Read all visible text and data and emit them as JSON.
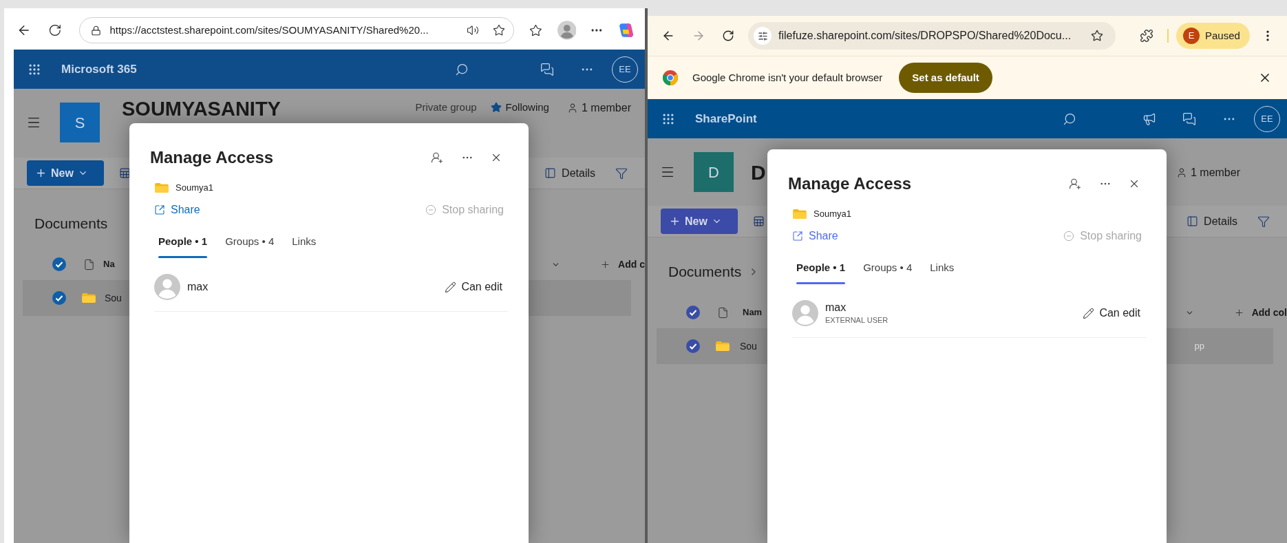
{
  "left_window": {
    "address": "https://acctstest.sharepoint.com/sites/SOUMYASANITY/Shared%20...",
    "suite_bar": {
      "title": "Microsoft 365",
      "avatar": "EE"
    },
    "site": {
      "logo_letter": "S",
      "title": "SOUMYASANITY",
      "privacy": "Private group",
      "follow": "Following",
      "members": "1 member"
    },
    "command_bar": {
      "new": "New",
      "details": "Details"
    },
    "library": {
      "title": "Documents",
      "header_checked": true,
      "columns": [
        "Na",
        "Add c"
      ],
      "rows": [
        {
          "name": "Sou",
          "selected": true
        }
      ]
    },
    "dialog": {
      "title": "Manage Access",
      "item": "Soumya1",
      "share": "Share",
      "stop_sharing": "Stop sharing",
      "tabs": [
        {
          "label": "People • 1",
          "selected": true
        },
        {
          "label": "Groups • 4",
          "selected": false
        },
        {
          "label": "Links",
          "selected": false
        }
      ],
      "people": [
        {
          "name": "max",
          "permission": "Can edit"
        }
      ]
    }
  },
  "right_window": {
    "address": "filefuze.sharepoint.com/sites/DROPSPO/Shared%20Docu...",
    "profile": {
      "initial": "E",
      "label": "Paused"
    },
    "banner": {
      "text": "Google Chrome isn't your default browser",
      "button": "Set as default"
    },
    "suite_bar": {
      "title": "SharePoint",
      "avatar": "EE"
    },
    "site": {
      "logo_letter": "D",
      "title": "D",
      "members": "1 member"
    },
    "command_bar": {
      "new": "New",
      "details": "Details"
    },
    "library": {
      "title": "Documents",
      "header_checked": true,
      "columns": [
        "Nam",
        "Add col"
      ],
      "rows": [
        {
          "name": "Sou",
          "column_2": "pp",
          "selected": true
        }
      ]
    },
    "dialog": {
      "title": "Manage Access",
      "item": "Soumya1",
      "share": "Share",
      "stop_sharing": "Stop sharing",
      "tabs": [
        {
          "label": "People • 1",
          "selected": true
        },
        {
          "label": "Groups • 4",
          "selected": false
        },
        {
          "label": "Links",
          "selected": false
        }
      ],
      "people": [
        {
          "name": "max",
          "subtitle": "EXTERNAL USER",
          "permission": "Can edit"
        }
      ]
    }
  }
}
